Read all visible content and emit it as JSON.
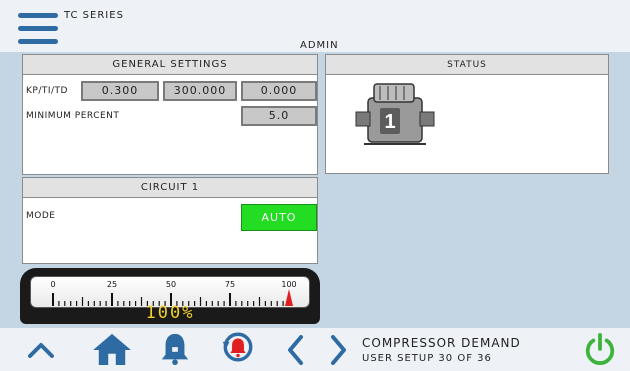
{
  "header": {
    "series": "TC SERIES",
    "user": "ADMIN"
  },
  "general_settings": {
    "title": "GENERAL SETTINGS",
    "kp_label": "KP/TI/TD",
    "kp_values": [
      "0.300",
      "300.000",
      "0.000"
    ],
    "min_percent_label": "MINIMUM PERCENT",
    "min_percent_value": "5.0"
  },
  "status": {
    "title": "STATUS",
    "compressor_number": "1"
  },
  "circuit": {
    "title": "CIRCUIT 1",
    "mode_label": "MODE",
    "mode_value": "AUTO"
  },
  "gauge": {
    "tick_labels": [
      "0",
      "25",
      "50",
      "75",
      "100"
    ],
    "readout": "100%",
    "value_percent": 100
  },
  "footer": {
    "title": "COMPRESSOR DEMAND",
    "subtitle": "USER SETUP 30 OF 36"
  },
  "icons": [
    "menu-icon",
    "chevron-up-icon",
    "home-icon",
    "bell-icon",
    "alarm-reset-icon",
    "chevron-left-icon",
    "chevron-right-icon",
    "power-icon"
  ],
  "colors": {
    "accent_blue": "#2e6ba3",
    "auto_green": "#22dd22",
    "power_green": "#3cb43c",
    "alarm_red": "#e02020",
    "gauge_yellow": "#f4d02c"
  }
}
